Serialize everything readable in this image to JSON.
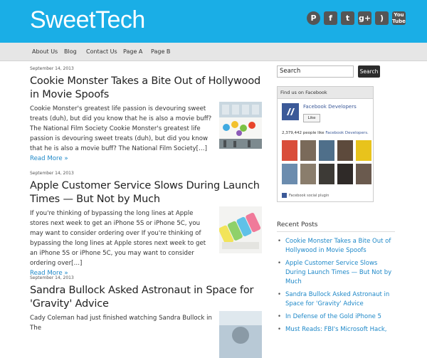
{
  "site": {
    "title": "SweetTech"
  },
  "social": [
    {
      "name": "pinterest-icon",
      "glyph": "P"
    },
    {
      "name": "facebook-icon",
      "glyph": "f"
    },
    {
      "name": "twitter-icon",
      "glyph": "t"
    },
    {
      "name": "google-plus-icon",
      "glyph": "g+"
    },
    {
      "name": "rss-icon",
      "glyph": ")"
    },
    {
      "name": "youtube-icon",
      "glyph": "You Tube"
    }
  ],
  "nav": {
    "about": "About Us",
    "blog": "Blog",
    "contact": "Contact Us",
    "page_a": "Page A",
    "page_b": "Page B"
  },
  "posts": [
    {
      "date": "September 14, 2013",
      "title": "Cookie Monster Takes a Bite Out of Hollywood in Movie Spoofs",
      "excerpt": "Cookie Monster's greatest life passion is devouring sweet treats (duh), but did you know that he is also a movie buff? The National Film Society Cookie Monster's greatest life passion is devouring sweet treats (duh), but did you know that he is also a movie buff? The National Film Society[…]",
      "more": "Read More »"
    },
    {
      "date": "September 14, 2013",
      "title": "Apple Customer Service Slows During Launch Times — But Not by Much",
      "excerpt": "If you're thinking of bypassing the long lines at Apple stores next week to get an iPhone 5S or iPhone 5C, you may want to consider ordering over If you're thinking of bypassing the long lines at Apple stores next week to get an iPhone 5S or iPhone 5C, you may want to consider ordering over[…]",
      "more": "Read More »"
    },
    {
      "date": "September 14, 2013",
      "title": "Sandra Bullock Asked Astronaut in Space for 'Gravity' Advice",
      "excerpt": "Cady Coleman had just finished watching Sandra Bullock in The",
      "more": ""
    }
  ],
  "sidebar": {
    "search_placeholder": "Search",
    "search_button": "Search",
    "facebook": {
      "heading": "Find us on Facebook",
      "page_name": "Facebook Developers",
      "like_label": "Like",
      "count_text": "2,379,442 people like ",
      "count_link": "Facebook Developers.",
      "footer": "Facebook social plugin"
    },
    "recent_title": "Recent Posts",
    "recent_posts": [
      "Cookie Monster Takes a Bite Out of Hollywood in Movie Spoofs",
      "Apple Customer Service Slows During Launch Times — But Not by Much",
      "Sandra Bullock Asked Astronaut in Space for 'Gravity' Advice",
      "In Defense of the Gold iPhone 5",
      "Must Reads: FBI's Microsoft Hack,"
    ]
  },
  "colors": {
    "header": "#1aaee6",
    "link": "#1e88c8",
    "facebook": "#3b5998"
  }
}
